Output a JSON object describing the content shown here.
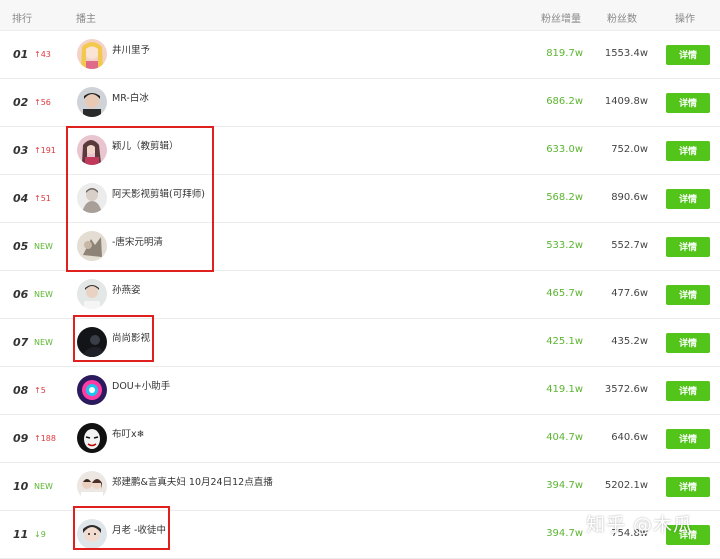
{
  "header": {
    "rank": "排行",
    "anchor": "播主",
    "fan_increase": "粉丝增量",
    "fans": "粉丝数",
    "action": "操作"
  },
  "rows": [
    {
      "rank": "01",
      "change": "↑43",
      "name": "井川里予",
      "increase": "819.7w",
      "fans": "1553.4w",
      "action": "详情"
    },
    {
      "rank": "02",
      "change": "↑56",
      "name": "MR-白冰",
      "increase": "686.2w",
      "fans": "1409.8w",
      "action": "详情"
    },
    {
      "rank": "03",
      "change": "↑191",
      "name": "颖儿（教剪辑）",
      "increase": "633.0w",
      "fans": "752.0w",
      "action": "详情"
    },
    {
      "rank": "04",
      "change": "↑51",
      "name": "阿天影视剪辑(可拜师)",
      "increase": "568.2w",
      "fans": "890.6w",
      "action": "详情"
    },
    {
      "rank": "05",
      "change": "NEW",
      "name": "-唐宋元明清",
      "increase": "533.2w",
      "fans": "552.7w",
      "action": "详情"
    },
    {
      "rank": "06",
      "change": "NEW",
      "name": "孙燕姿",
      "increase": "465.7w",
      "fans": "477.6w",
      "action": "详情"
    },
    {
      "rank": "07",
      "change": "NEW",
      "name": "尚尚影视",
      "increase": "425.1w",
      "fans": "435.2w",
      "action": "详情"
    },
    {
      "rank": "08",
      "change": "↑5",
      "name": "DOU+小助手",
      "increase": "419.1w",
      "fans": "3572.6w",
      "action": "详情"
    },
    {
      "rank": "09",
      "change": "↑188",
      "name": "布叮x❄",
      "increase": "404.7w",
      "fans": "640.6w",
      "action": "详情"
    },
    {
      "rank": "10",
      "change": "NEW",
      "name": "郑建鹏&言真夫妇 10月24日12点直播",
      "increase": "394.7w",
      "fans": "5202.1w",
      "action": "详情"
    },
    {
      "rank": "11",
      "change": "↓9",
      "name": "月老 -收徒中",
      "increase": "394.7w",
      "fans": "754.8w",
      "action": "详情"
    }
  ],
  "colors": {
    "accent_green": "#52c41a",
    "increase_green": "#5cb531",
    "rank_up_red": "#e0393e",
    "highlight_box": "#e0201f"
  },
  "watermark": "知乎 @木瓜"
}
